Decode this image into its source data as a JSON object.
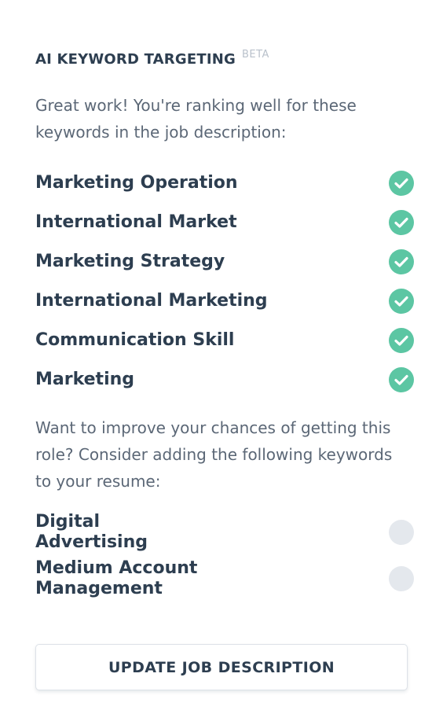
{
  "header": {
    "title": "AI KEYWORD TARGETING",
    "badge": "BETA"
  },
  "intro_text": "Great work! You're ranking well for these keywords in the job description:",
  "matched_keywords": [
    {
      "label": "Marketing Operation",
      "status": "matched",
      "icon": "check-circle-icon"
    },
    {
      "label": "International Market",
      "status": "matched",
      "icon": "check-circle-icon"
    },
    {
      "label": "Marketing Strategy",
      "status": "matched",
      "icon": "check-circle-icon"
    },
    {
      "label": "International Marketing",
      "status": "matched",
      "icon": "check-circle-icon"
    },
    {
      "label": "Communication Skill",
      "status": "matched",
      "icon": "check-circle-icon"
    },
    {
      "label": "Marketing",
      "status": "matched",
      "icon": "check-circle-icon"
    }
  ],
  "suggestion_text": "Want to improve your chances of getting this role? Consider adding the following keywords to your resume:",
  "missing_keywords": [
    {
      "label": "Digital Advertising",
      "status": "missing",
      "icon": "empty-circle-icon"
    },
    {
      "label": "Medium Account Management",
      "status": "missing",
      "icon": "empty-circle-icon"
    }
  ],
  "update_button": {
    "label": "UPDATE JOB DESCRIPTION"
  },
  "colors": {
    "text_dark": "#2d3e50",
    "text_muted": "#5b6776",
    "badge": "#b9c1cb",
    "matched": "#5cc6a3",
    "missing": "#e4e8ed"
  }
}
